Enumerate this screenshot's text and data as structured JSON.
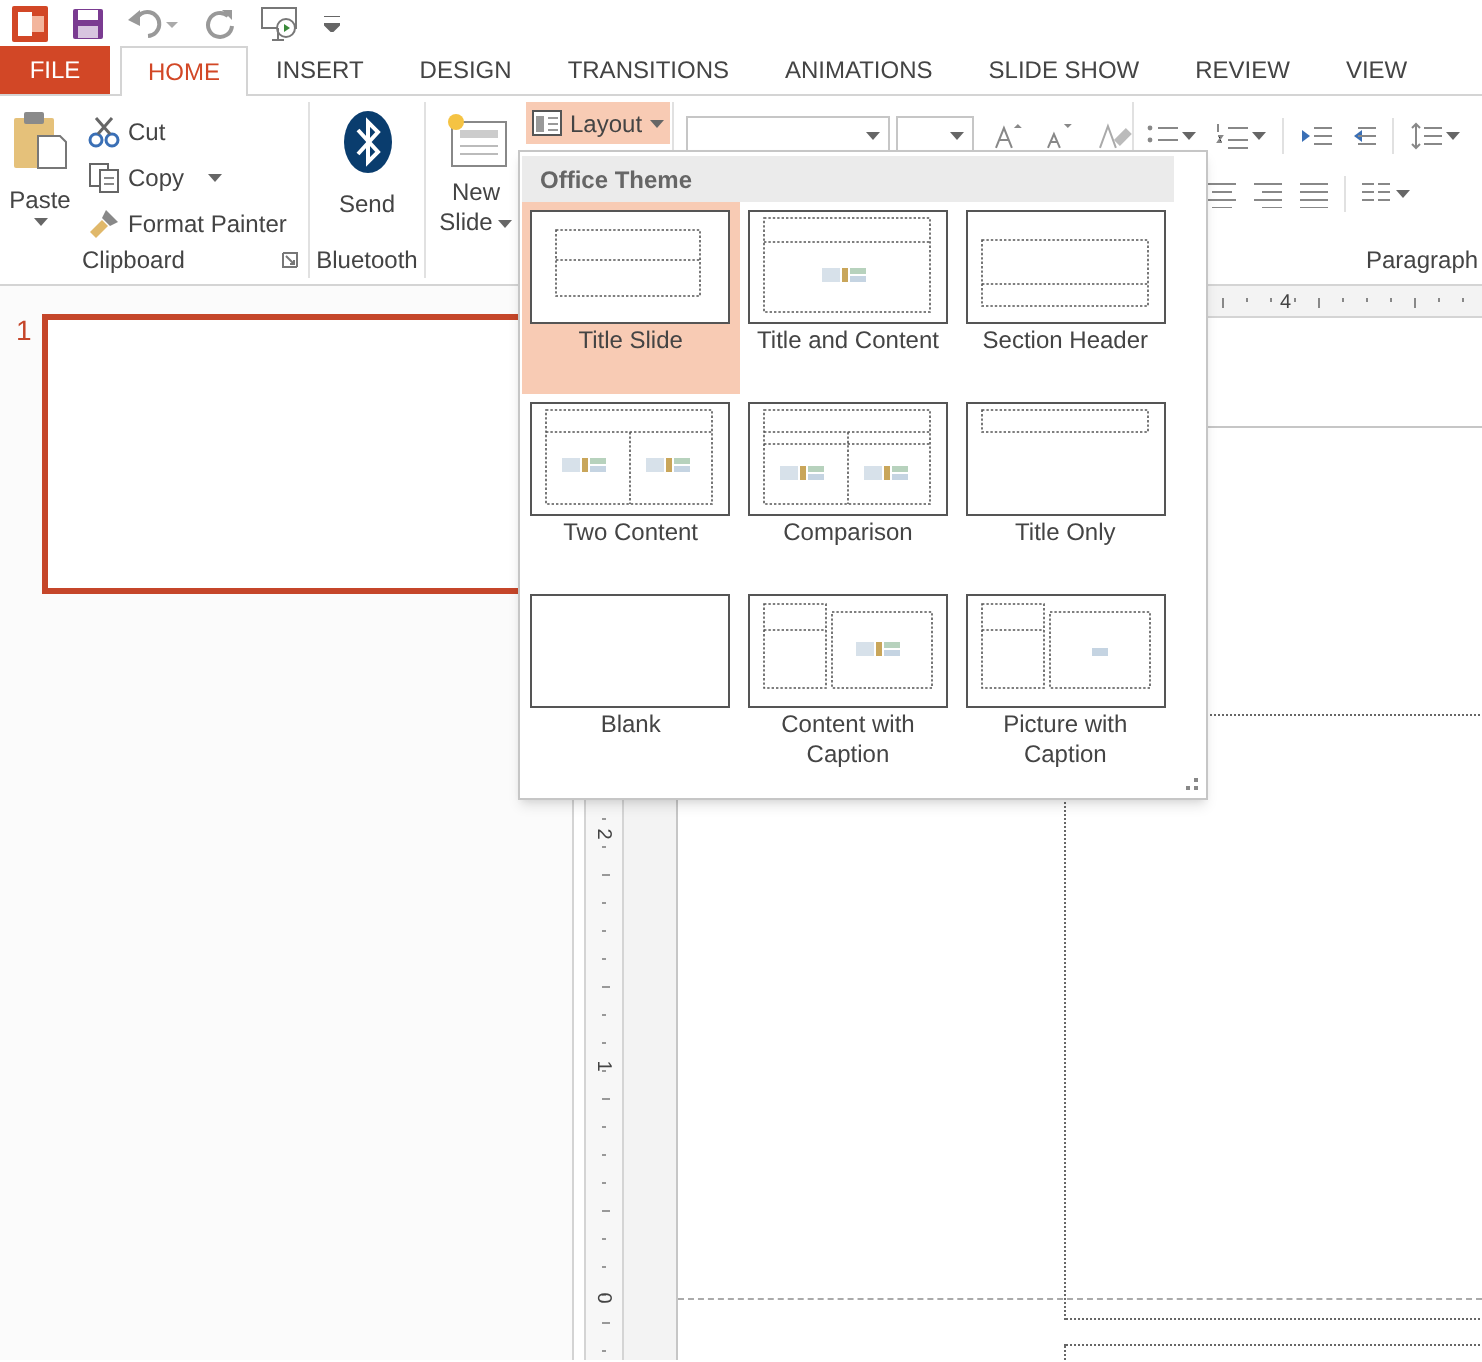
{
  "tabs": [
    {
      "label": "FILE",
      "kind": "file",
      "selected": false
    },
    {
      "label": "HOME",
      "kind": "tab",
      "selected": true
    },
    {
      "label": "INSERT",
      "kind": "tab",
      "selected": false
    },
    {
      "label": "DESIGN",
      "kind": "tab",
      "selected": false
    },
    {
      "label": "TRANSITIONS",
      "kind": "tab",
      "selected": false
    },
    {
      "label": "ANIMATIONS",
      "kind": "tab",
      "selected": false
    },
    {
      "label": "SLIDE SHOW",
      "kind": "tab",
      "selected": false
    },
    {
      "label": "REVIEW",
      "kind": "tab",
      "selected": false
    },
    {
      "label": "VIEW",
      "kind": "tab",
      "selected": false
    }
  ],
  "ribbon": {
    "clipboard": {
      "paste": "Paste",
      "cut": "Cut",
      "copy": "Copy",
      "format_painter": "Format Painter",
      "label": "Clipboard"
    },
    "bluetooth": {
      "send": "Send",
      "label": "Bluetooth"
    },
    "slides": {
      "new_slide_line_1": "New",
      "new_slide_line_2": "Slide",
      "layout": {
        "label": "Layout",
        "open": true
      }
    },
    "paragraph": {
      "label": "Paragraph"
    }
  },
  "layout_gallery": {
    "title": "Office Theme",
    "layouts": [
      {
        "name": "Title Slide",
        "kind": "title_slide",
        "selected": true
      },
      {
        "name": "Title and Content",
        "kind": "title_content",
        "selected": false
      },
      {
        "name": "Section Header",
        "kind": "section_header",
        "selected": false
      },
      {
        "name": "Two Content",
        "kind": "two_content",
        "selected": false
      },
      {
        "name": "Comparison",
        "kind": "comparison",
        "selected": false
      },
      {
        "name": "Title Only",
        "kind": "title_only",
        "selected": false
      },
      {
        "name": "Blank",
        "kind": "blank",
        "selected": false
      },
      {
        "name": "Content with Caption",
        "kind": "content_caption",
        "selected": false
      },
      {
        "name": "Picture with Caption",
        "kind": "picture_caption",
        "selected": false
      }
    ]
  },
  "slide_thumbnails": [
    {
      "number": "1",
      "selected": true
    }
  ],
  "rulers": {
    "horizontal": [
      "4"
    ],
    "vertical": [
      "2",
      "1",
      "0"
    ]
  }
}
